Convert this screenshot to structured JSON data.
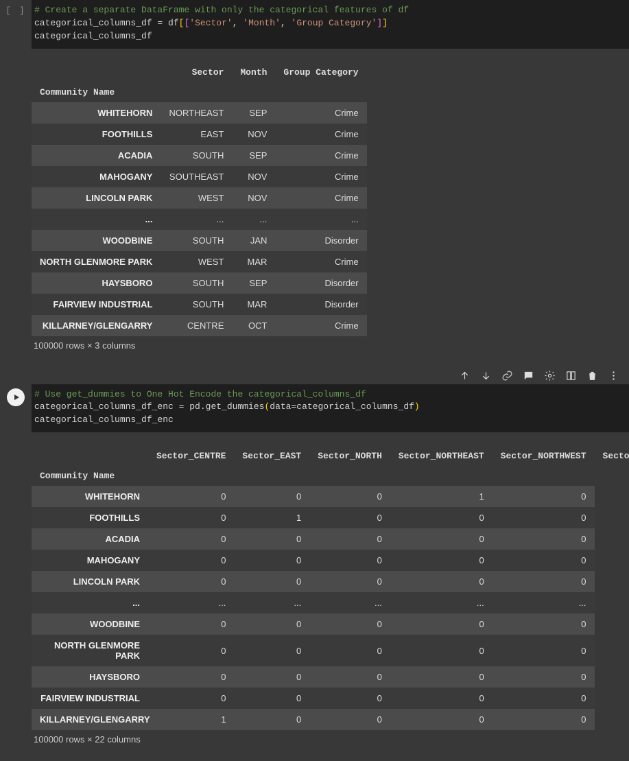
{
  "cell1": {
    "prompt": "[ ]",
    "comment": "# Create a separate DataFrame with only the categorical features of df",
    "line2_pre": "categorical_columns_df = df",
    "line2_cols": [
      "'Sector'",
      "'Month'",
      "'Group Category'"
    ],
    "line3": "categorical_columns_df"
  },
  "table1": {
    "columns": [
      "Sector",
      "Month",
      "Group Category"
    ],
    "indexName": "Community Name",
    "rows": [
      {
        "idx": "WHITEHORN",
        "vals": [
          "NORTHEAST",
          "SEP",
          "Crime"
        ]
      },
      {
        "idx": "FOOTHILLS",
        "vals": [
          "EAST",
          "NOV",
          "Crime"
        ]
      },
      {
        "idx": "ACADIA",
        "vals": [
          "SOUTH",
          "SEP",
          "Crime"
        ]
      },
      {
        "idx": "MAHOGANY",
        "vals": [
          "SOUTHEAST",
          "NOV",
          "Crime"
        ]
      },
      {
        "idx": "LINCOLN PARK",
        "vals": [
          "WEST",
          "NOV",
          "Crime"
        ]
      },
      {
        "idx": "...",
        "vals": [
          "...",
          "...",
          "..."
        ]
      },
      {
        "idx": "WOODBINE",
        "vals": [
          "SOUTH",
          "JAN",
          "Disorder"
        ]
      },
      {
        "idx": "NORTH GLENMORE PARK",
        "vals": [
          "WEST",
          "MAR",
          "Crime"
        ]
      },
      {
        "idx": "HAYSBORO",
        "vals": [
          "SOUTH",
          "SEP",
          "Disorder"
        ]
      },
      {
        "idx": "FAIRVIEW INDUSTRIAL",
        "vals": [
          "SOUTH",
          "MAR",
          "Disorder"
        ]
      },
      {
        "idx": "KILLARNEY/GLENGARRY",
        "vals": [
          "CENTRE",
          "OCT",
          "Crime"
        ]
      }
    ],
    "shape": "100000 rows × 3 columns"
  },
  "cell2": {
    "comment": "# Use get_dummies to One Hot Encode the categorical_columns_df",
    "line2_a": "categorical_columns_df_enc = pd.get_dummies",
    "line2_b": "data=categorical_columns_df",
    "line3": "categorical_columns_df_enc"
  },
  "table2": {
    "columns": [
      "Sector_CENTRE",
      "Sector_EAST",
      "Sector_NORTH",
      "Sector_NORTHEAST",
      "Sector_NORTHWEST",
      "Sector_S"
    ],
    "indexName": "Community Name",
    "rows": [
      {
        "idx": "WHITEHORN",
        "vals": [
          "0",
          "0",
          "0",
          "1",
          "0"
        ]
      },
      {
        "idx": "FOOTHILLS",
        "vals": [
          "0",
          "1",
          "0",
          "0",
          "0"
        ]
      },
      {
        "idx": "ACADIA",
        "vals": [
          "0",
          "0",
          "0",
          "0",
          "0"
        ]
      },
      {
        "idx": "MAHOGANY",
        "vals": [
          "0",
          "0",
          "0",
          "0",
          "0"
        ]
      },
      {
        "idx": "LINCOLN PARK",
        "vals": [
          "0",
          "0",
          "0",
          "0",
          "0"
        ]
      },
      {
        "idx": "...",
        "vals": [
          "...",
          "...",
          "...",
          "...",
          "..."
        ]
      },
      {
        "idx": "WOODBINE",
        "vals": [
          "0",
          "0",
          "0",
          "0",
          "0"
        ]
      },
      {
        "idx": "NORTH GLENMORE PARK",
        "vals": [
          "0",
          "0",
          "0",
          "0",
          "0"
        ]
      },
      {
        "idx": "HAYSBORO",
        "vals": [
          "0",
          "0",
          "0",
          "0",
          "0"
        ]
      },
      {
        "idx": "FAIRVIEW INDUSTRIAL",
        "vals": [
          "0",
          "0",
          "0",
          "0",
          "0"
        ]
      },
      {
        "idx": "KILLARNEY/GLENGARRY",
        "vals": [
          "1",
          "0",
          "0",
          "0",
          "0"
        ]
      }
    ],
    "shape": "100000 rows × 22 columns"
  },
  "toolbar": {
    "items": [
      "up-icon",
      "down-icon",
      "link-icon",
      "comment-icon",
      "gear-icon",
      "mirror-icon",
      "trash-icon",
      "more-icon"
    ]
  }
}
